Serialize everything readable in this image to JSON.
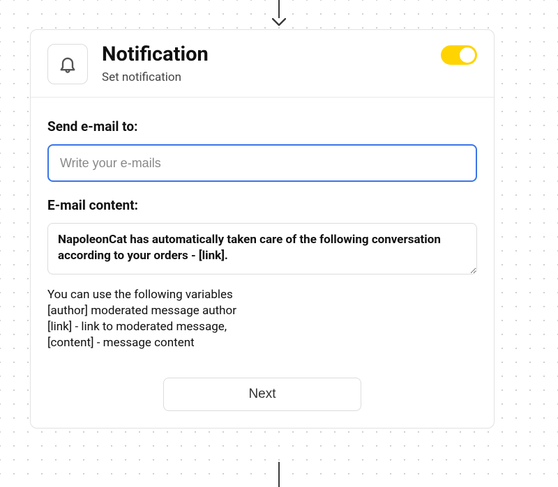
{
  "header": {
    "title": "Notification",
    "subtitle": "Set notification",
    "toggle_on": true
  },
  "form": {
    "send_to_label": "Send e-mail to:",
    "send_to_placeholder": "Write your e-mails",
    "content_label": "E-mail content:",
    "content_value": "NapoleonCat has automatically taken care of the following conversation according to your orders - [link].",
    "variables_intro": "You can use the following variables",
    "variables": [
      "[author] moderated message author",
      "[link] - link to moderated message,",
      "[content] - message content"
    ]
  },
  "actions": {
    "next_label": "Next"
  }
}
